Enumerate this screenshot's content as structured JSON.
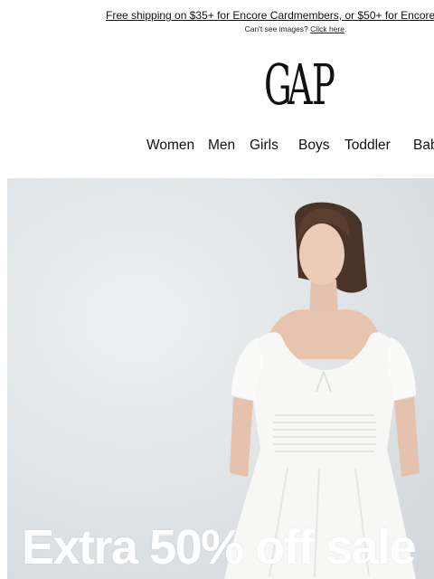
{
  "promo": {
    "text": "Free shipping on $35+ for Encore Cardmembers, or $50+ for Encore"
  },
  "images_notice": {
    "text": "Can't see images?",
    "link": "Click here",
    "suffix": "."
  },
  "brand": {
    "logo_letters": [
      "G",
      "A",
      "P"
    ]
  },
  "nav": {
    "items": [
      "Women",
      "Men",
      "Girls",
      "Boys",
      "Toddler",
      "Baby"
    ]
  },
  "hero": {
    "headline": "Extra 50% off sale",
    "image": "woman in white smocked dress"
  },
  "colors": {
    "background": "#ffffff",
    "text": "#111111",
    "hero_bg": "#e2e5e7",
    "headline": "#ffffff"
  }
}
